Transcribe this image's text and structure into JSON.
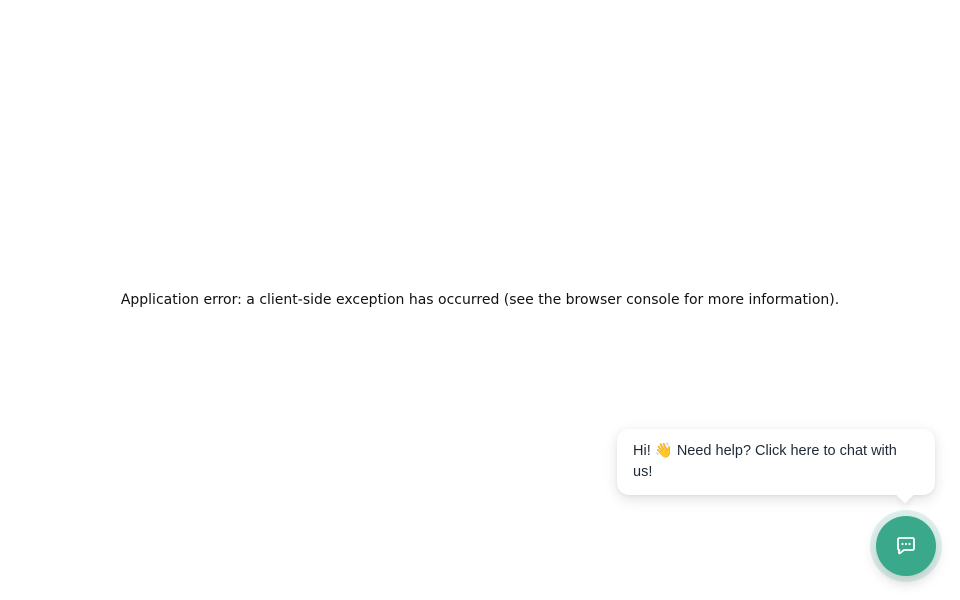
{
  "error": {
    "message": "Application error: a client-side exception has occurred (see the browser console for more information)."
  },
  "chat_widget": {
    "greeting": "Hi! 👋 Need help? Click here to chat with us!",
    "button_icon": "chat-bubble-icon",
    "accent_color": "#3aa88a"
  }
}
